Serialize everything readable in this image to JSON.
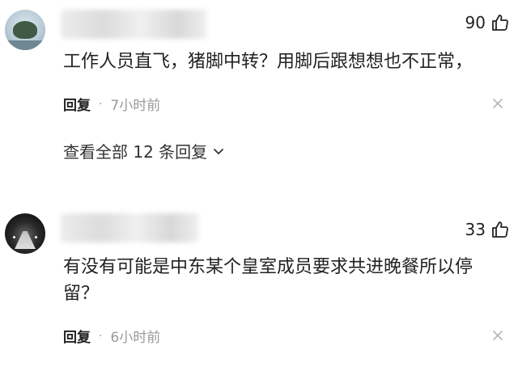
{
  "comments": [
    {
      "likes": "90",
      "text": "工作人员直飞，猪脚中转？用脚后跟想想也不正常，",
      "reply_label": "回复",
      "separator": "·",
      "time": "7小时前"
    },
    {
      "likes": "33",
      "text": "有没有可能是中东某个皇室成员要求共进晚餐所以停留？",
      "reply_label": "回复",
      "separator": "·",
      "time": "6小时前"
    }
  ],
  "view_all_replies": "查看全部 12 条回复",
  "icons": {
    "like": "thumbs-up-icon",
    "close": "close-icon",
    "expand": "chevron-down-icon"
  },
  "colors": {
    "text": "#222222",
    "muted": "#9a9a9a",
    "background": "#ffffff"
  }
}
